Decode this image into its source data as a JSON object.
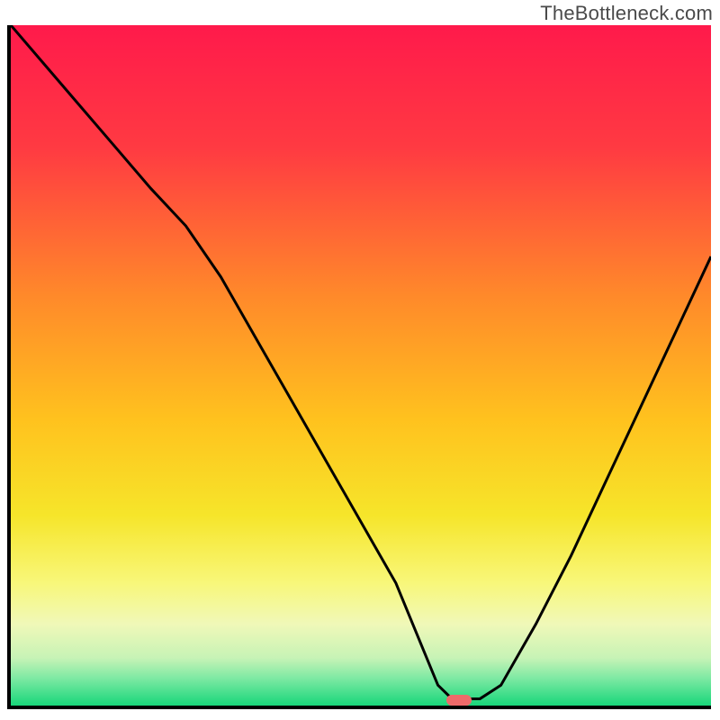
{
  "watermark": "TheBottleneck.com",
  "chart_data": {
    "type": "line",
    "title": "",
    "xlabel": "",
    "ylabel": "",
    "xlim": [
      0,
      100
    ],
    "ylim": [
      0,
      100
    ],
    "x": [
      0,
      5,
      10,
      15,
      20,
      25,
      30,
      35,
      40,
      45,
      50,
      55,
      59,
      61,
      63,
      67,
      70,
      75,
      80,
      85,
      90,
      95,
      100
    ],
    "y": [
      100,
      94,
      88,
      82,
      76,
      70.5,
      63,
      54,
      45,
      36,
      27,
      18,
      8,
      3,
      1,
      1,
      3,
      12,
      22,
      33,
      44,
      55,
      66
    ],
    "gradient_stops": [
      {
        "pos": 0.0,
        "color": "#ff1a4b"
      },
      {
        "pos": 0.18,
        "color": "#ff3a42"
      },
      {
        "pos": 0.4,
        "color": "#ff8a2a"
      },
      {
        "pos": 0.58,
        "color": "#ffc21e"
      },
      {
        "pos": 0.72,
        "color": "#f6e52a"
      },
      {
        "pos": 0.82,
        "color": "#f8f77a"
      },
      {
        "pos": 0.88,
        "color": "#f0f8b8"
      },
      {
        "pos": 0.93,
        "color": "#c7f3b6"
      },
      {
        "pos": 0.96,
        "color": "#7de9a3"
      },
      {
        "pos": 1.0,
        "color": "#18d67a"
      }
    ],
    "marker": {
      "x": 64,
      "y": 0.8,
      "color": "#ef6a6a"
    },
    "curve_color": "#000000",
    "curve_width": 3
  }
}
